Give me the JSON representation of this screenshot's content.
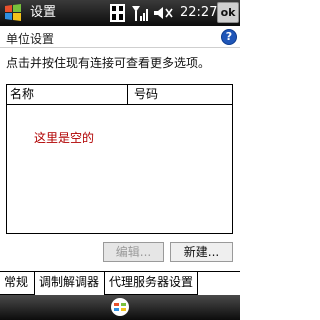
{
  "titlebar": {
    "title": "设置",
    "time": "22:27",
    "ok_label": "ok",
    "icons": [
      "windows-start-icon",
      "connectivity-icon",
      "signal-icon",
      "volume-icon"
    ]
  },
  "section": {
    "title": "单位设置",
    "help_label": "?"
  },
  "instruction": "点击并按住现有连接可查看更多选项。",
  "list": {
    "columns": [
      "名称",
      "号码"
    ],
    "empty_text": "这里是空的"
  },
  "buttons": {
    "edit_label": "编辑...",
    "new_label": "新建..."
  },
  "tabs": [
    "常规",
    "调制解调器",
    "代理服务器设置"
  ],
  "bottombar": {
    "icon": "sip-keyboard-icon"
  }
}
